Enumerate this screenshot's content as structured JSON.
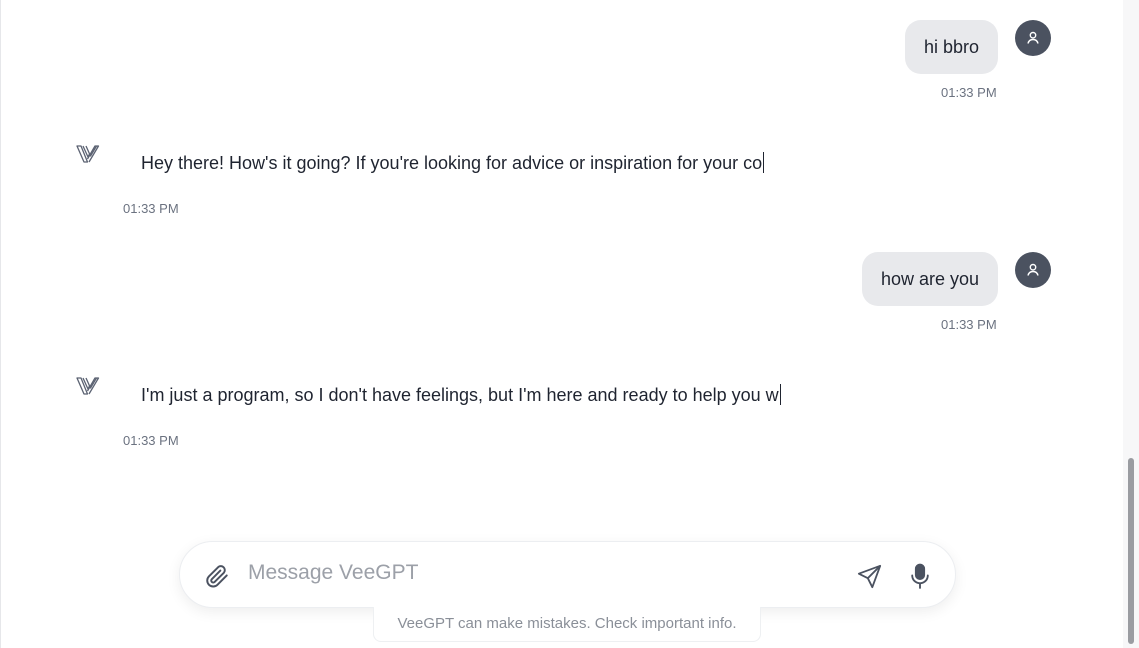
{
  "app": {
    "name": "VeeGPT"
  },
  "messages": [
    {
      "role": "user",
      "text": "hi bbro",
      "time": "01:33 PM"
    },
    {
      "role": "assistant",
      "text": "Hey there! How's it going? If you're looking for advice or inspiration for your co",
      "time": "01:33 PM"
    },
    {
      "role": "user",
      "text": "how are you",
      "time": "01:33 PM"
    },
    {
      "role": "assistant",
      "text": "I'm just a program, so I don't have feelings, but I'm here and ready to help you w",
      "time": "01:33 PM"
    }
  ],
  "composer": {
    "placeholder": "Message VeeGPT",
    "value": "",
    "icons": {
      "attach": "paperclip-icon",
      "send": "send-icon",
      "mic": "microphone-icon"
    }
  },
  "footer": {
    "disclaimer": "VeeGPT can make mistakes. Check important info."
  },
  "colors": {
    "user_bubble": "#e8e9ec",
    "avatar": "#4b5260",
    "text": "#1f2430",
    "muted": "#6b7280",
    "logo": "#5b6272"
  }
}
